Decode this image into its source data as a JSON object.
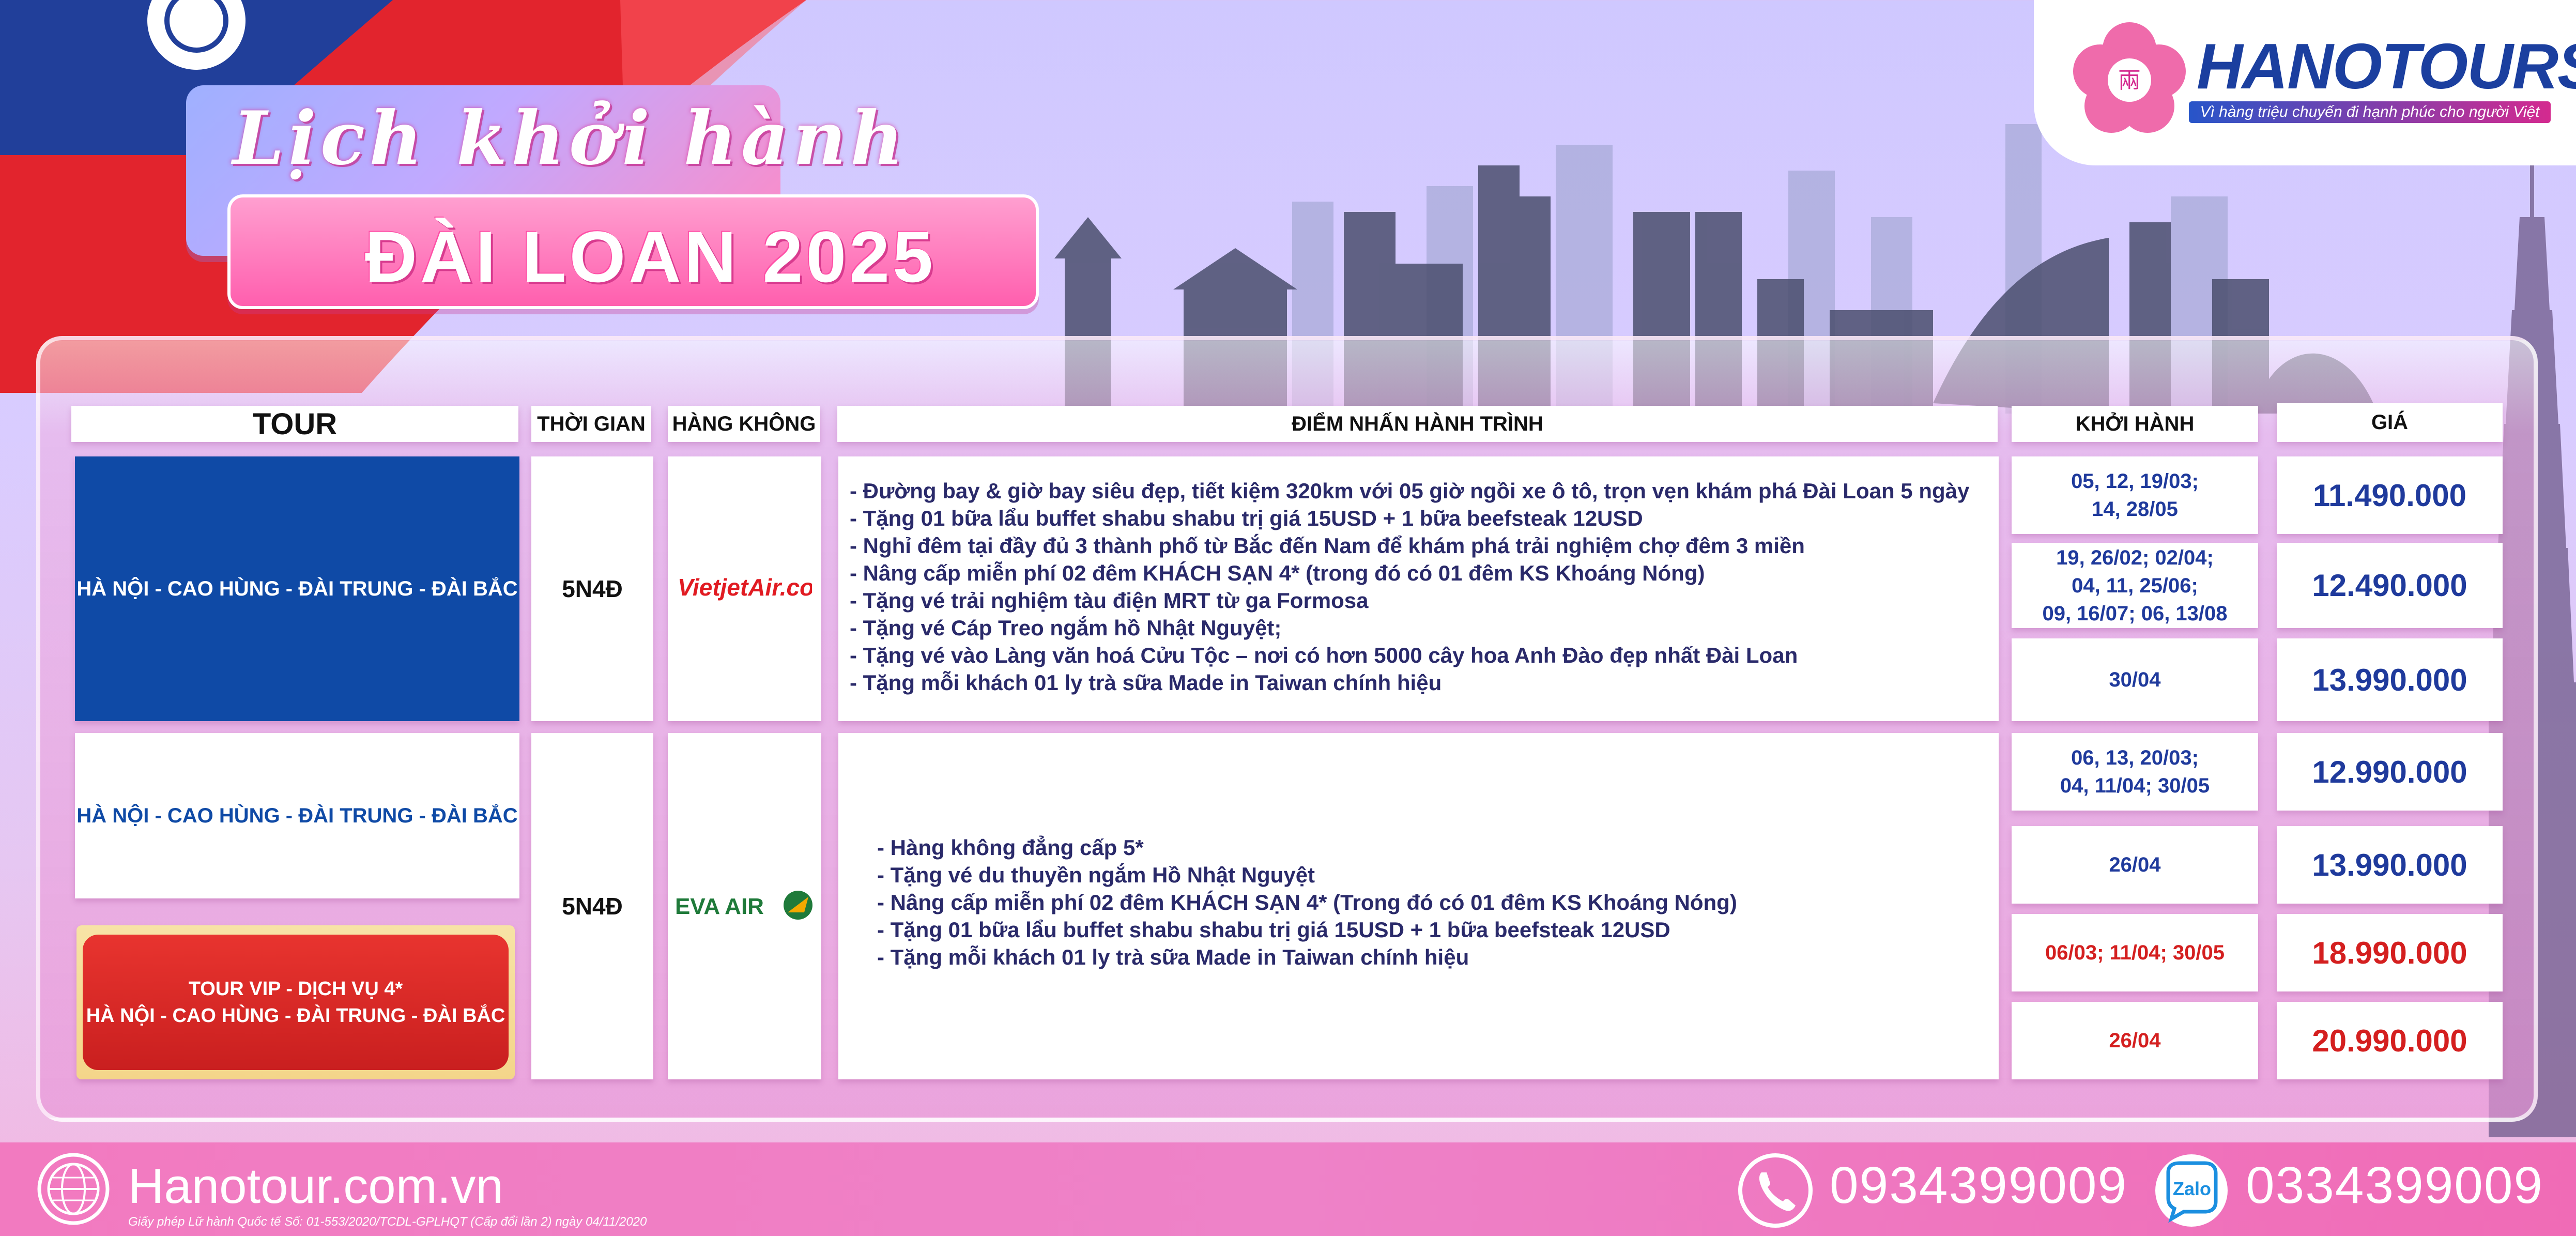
{
  "title": {
    "line1": "Lịch khởi hành",
    "line2": "ĐÀI LOAN 2025"
  },
  "logo": {
    "name": "HANOTOURS",
    "tagline": "Vì hàng triệu chuyến đi hạnh phúc cho người Việt"
  },
  "table": {
    "headers": {
      "tour": "TOUR",
      "duration": "THỜI GIAN",
      "airline": "HÀNG KHÔNG",
      "highlights": "ĐIỂM NHẤN HÀNH TRÌNH",
      "departure": "KHỞI HÀNH",
      "price": "GIÁ"
    },
    "group1": {
      "tour": "HÀ NỘI - CAO HÙNG - ĐÀI TRUNG - ĐÀI BẮC",
      "duration": "5N4Đ",
      "airline": "VietjetAir.com",
      "highlights": [
        "- Đường bay & giờ bay siêu đẹp, tiết kiệm 320km với 05 giờ ngồi xe ô tô, trọn vẹn khám phá Đài Loan 5 ngày",
        "- Tặng 01 bữa lẩu buffet shabu shabu trị giá 15USD + 1 bữa beefsteak 12USD",
        "- Nghỉ đêm tại đầy đủ 3 thành phố từ Bắc đến Nam để khám phá trải nghiệm chợ đêm 3 miền",
        "- Nâng cấp miễn phí 02 đêm KHÁCH SẠN 4* (trong đó có 01 đêm KS Khoáng Nóng)",
        "- Tặng vé trải nghiệm tàu điện MRT từ ga Formosa",
        "- Tặng vé Cáp Treo ngắm hồ Nhật Nguyệt;",
        "- Tặng vé vào Làng văn hoá Cửu Tộc – nơi có hơn 5000 cây hoa Anh Đào đẹp nhất Đài Loan",
        "- Tặng mỗi khách 01 ly trà sữa Made in Taiwan chính hiệu"
      ],
      "rows": [
        {
          "departure": [
            "05, 12, 19/03;",
            "14, 28/05"
          ],
          "price": "11.490.000"
        },
        {
          "departure": [
            "19, 26/02; 02/04;",
            "04, 11, 25/06;",
            "09, 16/07; 06, 13/08"
          ],
          "price": "12.490.000"
        },
        {
          "departure": [
            "30/04"
          ],
          "price": "13.990.000"
        }
      ]
    },
    "group2": {
      "tour": "HÀ NỘI - CAO HÙNG - ĐÀI TRUNG - ĐÀI BẮC",
      "vip_line1": "TOUR VIP - DỊCH VỤ 4*",
      "vip_line2": "HÀ NỘI - CAO HÙNG - ĐÀI TRUNG - ĐÀI BẮC",
      "duration": "5N4Đ",
      "airline": "EVA AIR",
      "highlights": [
        "- Hàng không đẳng cấp 5*",
        "- Tặng vé du thuyền ngắm Hồ Nhật Nguyệt",
        "- Nâng cấp miễn phí 02 đêm KHÁCH SẠN 4* (Trong đó có 01 đêm KS Khoáng Nóng)",
        "- Tặng 01 bữa lẩu buffet shabu shabu trị giá 15USD + 1 bữa beefsteak 12USD",
        "- Tặng mỗi khách 01 ly trà sữa Made in Taiwan chính hiệu"
      ],
      "rows": [
        {
          "departure": [
            "06, 13, 20/03;",
            "04, 11/04; 30/05"
          ],
          "price": "12.990.000"
        },
        {
          "departure": [
            "26/04"
          ],
          "price": "13.990.000"
        },
        {
          "departure": [
            "06/03; 11/04; 30/05"
          ],
          "price": "18.990.000"
        },
        {
          "departure": [
            "26/04"
          ],
          "price": "20.990.000"
        }
      ]
    }
  },
  "footer": {
    "website": "Hanotour.com.vn",
    "license": "Giấy phép Lữ hành Quốc tế Số: 01-553/2020/TCDL-GPLHQT (Cấp đổi lần 2) ngày 04/11/2020",
    "phone1": "0934399009",
    "zalo_label": "Zalo",
    "phone2": "0334399009"
  },
  "colors": {
    "brand_blue": "#1b3f9f",
    "price_blue": "#1f3a9c",
    "vip_red": "#d41f1f",
    "pink": "#f06bb6"
  }
}
